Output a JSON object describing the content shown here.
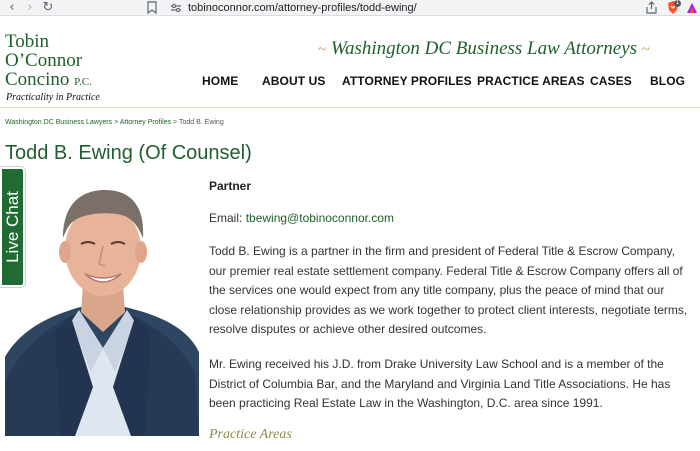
{
  "browser": {
    "url": "tobinoconnor.com/attorney-profiles/todd-ewing/",
    "brave_badge": "1"
  },
  "header": {
    "logo_lines": [
      "Tobin",
      "O’Connor",
      "Concino"
    ],
    "logo_suffix": "P.C.",
    "logo_tagline": "Practicality in Practice",
    "tagline": "Washington DC Business Law Attorneys",
    "tagline_ornament": "~"
  },
  "nav": {
    "items": [
      {
        "label": "HOME"
      },
      {
        "label": "ABOUT US"
      },
      {
        "label": "ATTORNEY PROFILES"
      },
      {
        "label": "PRACTICE AREAS"
      },
      {
        "label": "CASES"
      },
      {
        "label": "BLOG"
      }
    ]
  },
  "breadcrumb": {
    "items": [
      "Washington DC Business Lawyers",
      "Attorney Profiles"
    ],
    "current": "Todd B. Ewing",
    "separator": ">"
  },
  "profile": {
    "name_title": "Todd B. Ewing (Of Counsel)",
    "role": "Partner",
    "email_label": "Email:",
    "email": "tbewing@tobinoconnor.com",
    "bio_1": "Todd B. Ewing is a partner in the firm and president of Federal Title & Escrow Company, our premier real estate settlement company. Federal Title & Escrow Company offers all of the services one would expect from any title company, plus the peace of mind that our close relationship provides as we work together to protect client interests, negotiate terms, resolve disputes or achieve other desired outcomes.",
    "bio_2": "Mr. Ewing received his J.D. from Drake University Law School and is a member of the District of Columbia Bar, and the Maryland and Virginia Land Title Associations. He has been practicing Real Estate Law in the Washington, D.C. area since 1991.",
    "practice_areas_heading": "Practice Areas"
  },
  "live_chat": {
    "label": "Live Chat"
  },
  "colors": {
    "brand_green": "#1f5f2c",
    "chat_green": "#1f6b33",
    "gold": "#b39a4b",
    "olive": "#8c8a4a"
  }
}
